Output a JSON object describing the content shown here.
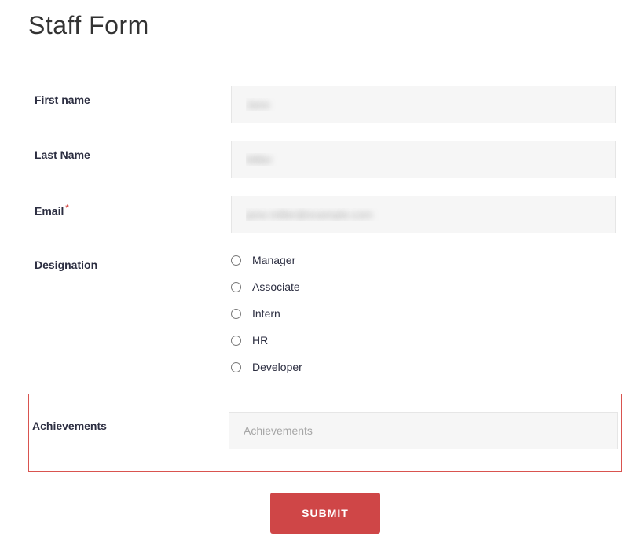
{
  "title": "Staff Form",
  "fields": {
    "first_name": {
      "label": "First name",
      "value": "Jane"
    },
    "last_name": {
      "label": "Last Name",
      "value": "Miller"
    },
    "email": {
      "label": "Email",
      "value": "jane.miller@example.com",
      "required": "*"
    },
    "designation": {
      "label": "Designation",
      "options": {
        "0": "Manager",
        "1": "Associate",
        "2": "Intern",
        "3": "HR",
        "4": "Developer"
      }
    },
    "achievements": {
      "label": "Achievements",
      "placeholder": "Achievements"
    }
  },
  "submit_label": "SUBMIT"
}
